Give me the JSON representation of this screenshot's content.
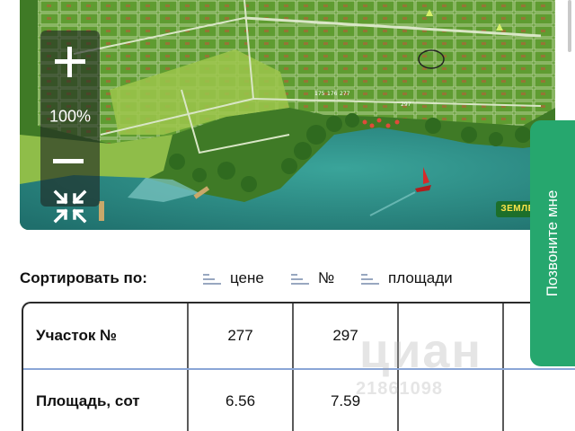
{
  "map": {
    "zoom_level": "100%",
    "plot_labels": [
      "175",
      "176",
      "277",
      "297"
    ],
    "logo_text": "ЗЕМЛЕТР"
  },
  "sort": {
    "label": "Сортировать по:",
    "options": [
      "цене",
      "№",
      "площади"
    ]
  },
  "table": {
    "rows": [
      {
        "header": "Участок №",
        "values": [
          "277",
          "297"
        ]
      },
      {
        "header": "Площадь, сот",
        "values": [
          "6.56",
          "7.59"
        ]
      }
    ]
  },
  "watermark": {
    "word": "циан",
    "number": "21861098"
  },
  "call_button": {
    "label": "Позвоните мне"
  },
  "colors": {
    "accent_green": "#26a76e",
    "lake": "#2e8f86",
    "sort_icon": "#98a7c0"
  },
  "icons": [
    "zoom-in-icon",
    "zoom-out-icon",
    "fit-to-screen-icon",
    "sort-icon",
    "boat-icon"
  ]
}
